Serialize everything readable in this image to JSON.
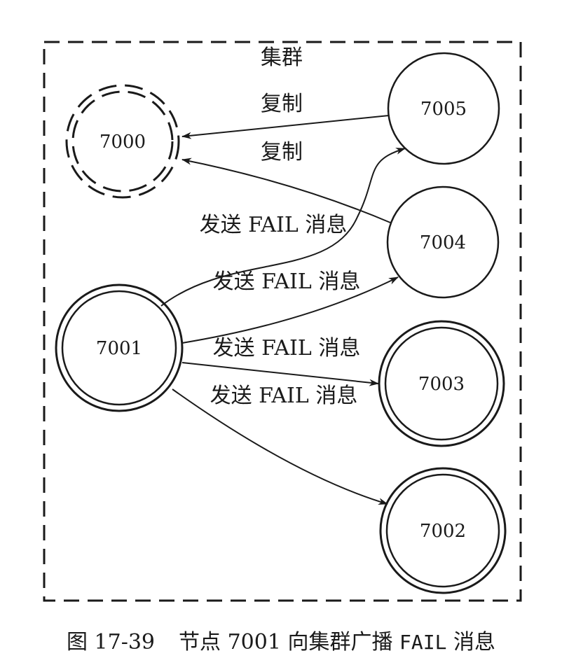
{
  "diagram": {
    "cluster_label": "集群",
    "nodes": [
      {
        "id": "7000",
        "label": "7000",
        "style": "dashed-double-circle"
      },
      {
        "id": "7001",
        "label": "7001",
        "style": "double-circle"
      },
      {
        "id": "7002",
        "label": "7002",
        "style": "double-circle"
      },
      {
        "id": "7003",
        "label": "7003",
        "style": "double-circle"
      },
      {
        "id": "7004",
        "label": "7004",
        "style": "circle"
      },
      {
        "id": "7005",
        "label": "7005",
        "style": "circle"
      }
    ],
    "edges": [
      {
        "from": "7005",
        "to": "7000",
        "label": "复制"
      },
      {
        "from": "7004",
        "to": "7000",
        "label": "复制"
      },
      {
        "from": "7001",
        "to": "7005",
        "label": "发送 FAIL 消息"
      },
      {
        "from": "7001",
        "to": "7004",
        "label": "发送 FAIL 消息"
      },
      {
        "from": "7001",
        "to": "7003",
        "label": "发送 FAIL 消息"
      },
      {
        "from": "7001",
        "to": "7002",
        "label": "发送 FAIL 消息"
      }
    ]
  },
  "caption": {
    "figure_number": "图 17-39",
    "text_before": "节点 7001 向集群广播",
    "code": "FAIL",
    "text_after": "消息"
  }
}
